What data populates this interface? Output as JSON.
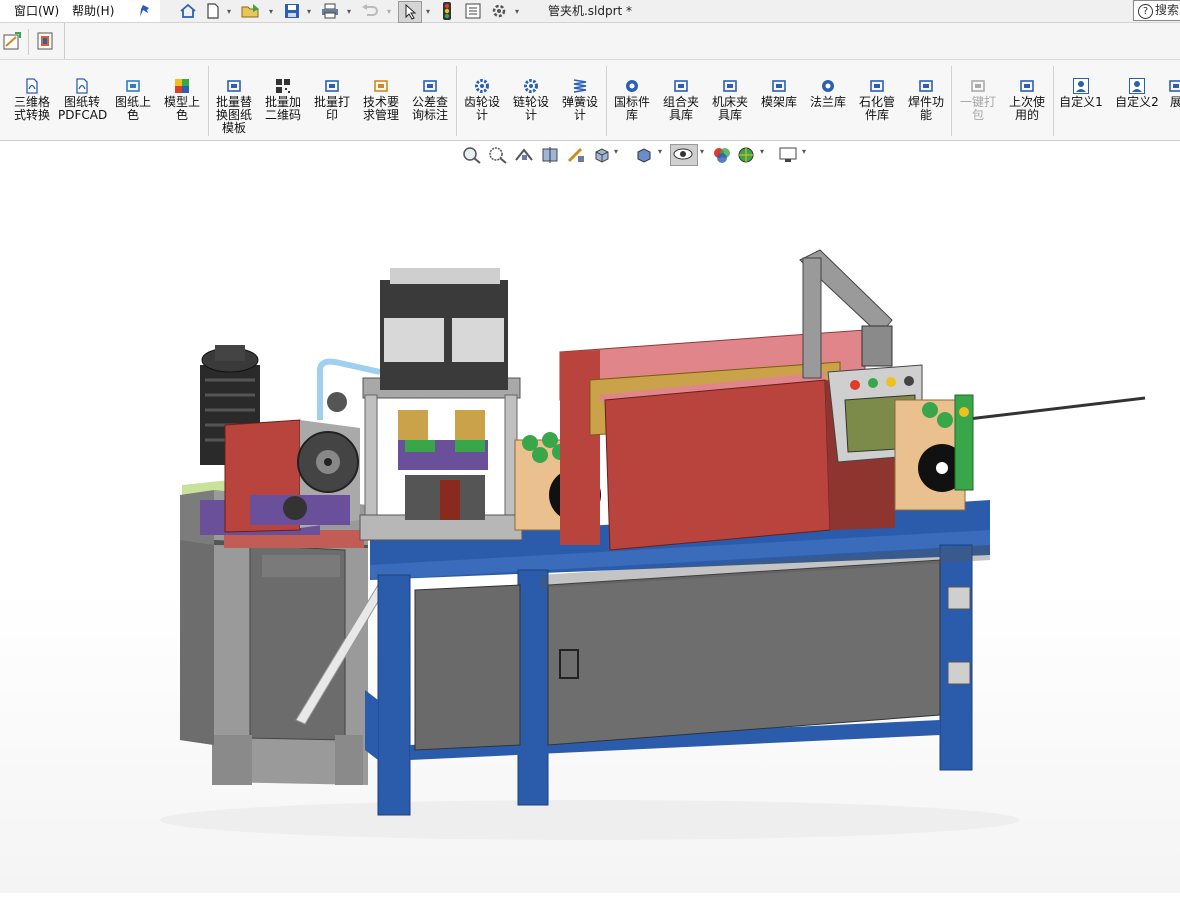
{
  "menu": {
    "window": "窗口(W)",
    "help": "帮助(H)"
  },
  "window_title": "管夹机.sldprt *",
  "search": {
    "label": "搜索"
  },
  "ribbon": {
    "items": [
      {
        "label": "三维格\n式转换",
        "icon": "convert-icon",
        "color": "#2b5fb5",
        "dim": false
      },
      {
        "label": "图纸转\nPDFCAD",
        "icon": "pdf-icon",
        "color": "#2b5fb5",
        "dim": false
      },
      {
        "label": "图纸上\n色",
        "icon": "layers-icon",
        "color": "#2b7fc8",
        "dim": false
      },
      {
        "label": "模型上\n色",
        "icon": "color-cube-icon",
        "color": "#e0602a",
        "dim": false
      },
      {
        "label": "批量替\n换图纸\n模板",
        "icon": "replace-icon",
        "color": "#2b5fb5",
        "dim": false
      },
      {
        "label": "批量加\n二维码",
        "icon": "qrcode-icon",
        "color": "#333333",
        "dim": false
      },
      {
        "label": "批量打\n印",
        "icon": "print-icon",
        "color": "#2b5fb5",
        "dim": false
      },
      {
        "label": "技术要\n求管理",
        "icon": "list-icon",
        "color": "#d08a20",
        "dim": false
      },
      {
        "label": "公差查\n询标注",
        "icon": "tolerance-icon",
        "color": "#2b5fb5",
        "dim": false
      },
      {
        "label": "齿轮设\n计",
        "icon": "gear-icon",
        "color": "#2b5fb5",
        "dim": false
      },
      {
        "label": "链轮设\n计",
        "icon": "sprocket-icon",
        "color": "#2b5fb5",
        "dim": false
      },
      {
        "label": "弹簧设\n计",
        "icon": "spring-icon",
        "color": "#2b5fb5",
        "dim": false
      },
      {
        "label": "国标件\n库",
        "icon": "nut-icon",
        "color": "#2b5fb5",
        "dim": false
      },
      {
        "label": "组合夹\n具库",
        "icon": "fixture-icon",
        "color": "#2b5fb5",
        "dim": false
      },
      {
        "label": "机床夹\n具库",
        "icon": "vise-icon",
        "color": "#2b5fb5",
        "dim": false
      },
      {
        "label": "模架库",
        "icon": "mold-icon",
        "color": "#2b5fb5",
        "dim": false
      },
      {
        "label": "法兰库",
        "icon": "flange-icon",
        "color": "#2b5fb5",
        "dim": false
      },
      {
        "label": "石化管\n件库",
        "icon": "pipe-icon",
        "color": "#2b5fb5",
        "dim": false
      },
      {
        "label": "焊件功\n能",
        "icon": "weld-icon",
        "color": "#2b5fb5",
        "dim": false
      },
      {
        "label": "一键打\n包",
        "icon": "package-icon",
        "color": "#aaaaaa",
        "dim": true
      },
      {
        "label": "上次使\n用的",
        "icon": "recent-icon",
        "color": "#2b5fb5",
        "dim": false
      },
      {
        "label": "自定义1",
        "icon": "user-icon",
        "color": "#2b5fb5",
        "dim": false
      },
      {
        "label": "自定义2",
        "icon": "user-icon",
        "color": "#2b5fb5",
        "dim": false
      },
      {
        "label": "展",
        "icon": "expand-icon",
        "color": "#2b5fb5",
        "dim": false
      }
    ]
  },
  "colors": {
    "frame_blue": "#2a5cab",
    "cabinet_gray": "#8f8f8f",
    "cover_red": "#b9433d",
    "plate_purple": "#6a4f9b",
    "green_part": "#3aa64a",
    "accent_pink": "#e0868a"
  }
}
